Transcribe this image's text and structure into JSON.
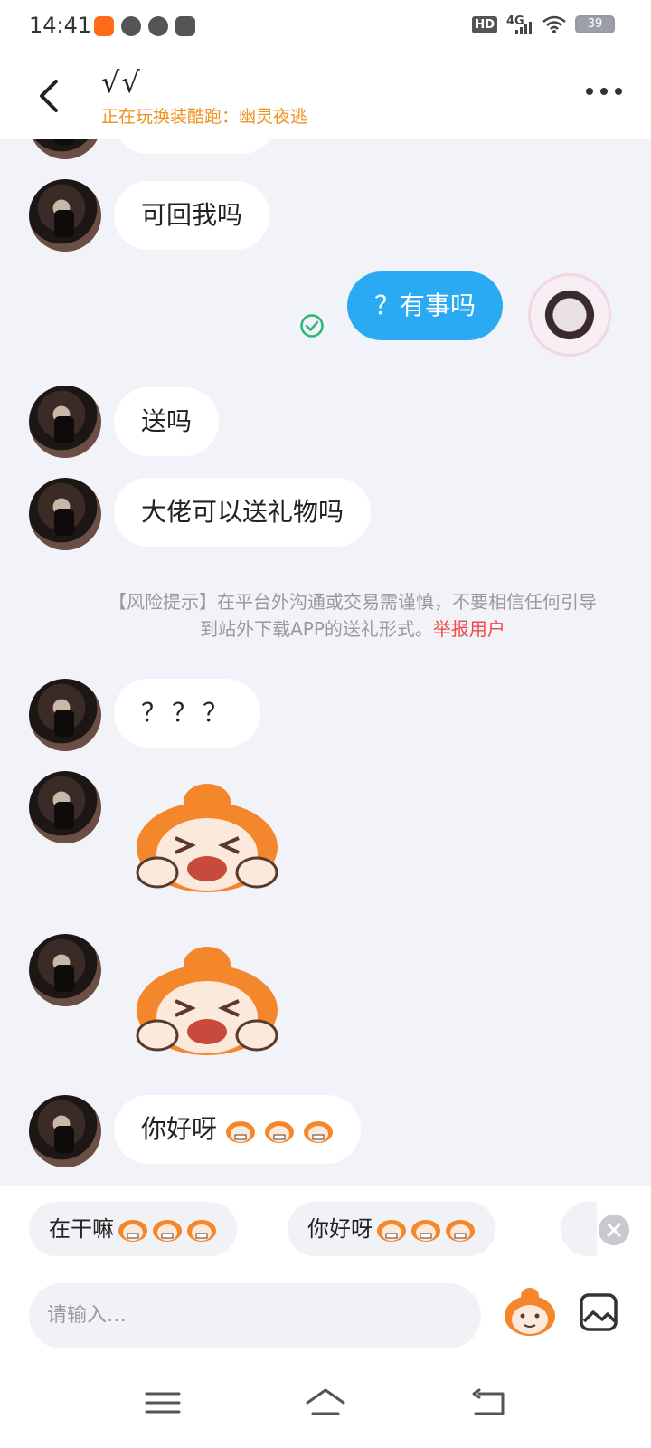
{
  "status_bar": {
    "time": "14:41",
    "network": "4G",
    "hd": "HD",
    "battery": "39"
  },
  "header": {
    "title": "√√",
    "subtitle": "正在玩换装酷跑：幽灵夜逃"
  },
  "messages": {
    "m1": "可回我吗",
    "m2": "？有事吗",
    "m3": "送吗",
    "m4": "大佬可以送礼物吗",
    "m5": "？？？",
    "m6": "你好呀"
  },
  "risk_notice": {
    "text": "【风险提示】在平台外沟通或交易需谨慎，不要相信任何引导到站外下载APP的送礼形式。",
    "report_link": "举报用户"
  },
  "quick_replies": [
    "在干嘛",
    "你好呀"
  ],
  "input": {
    "placeholder": "请输入…"
  },
  "colors": {
    "accent_blue": "#2aaaf3",
    "orange": "#f0911f",
    "report_red": "#ef4a4a",
    "sent_green": "#2bb673"
  },
  "icons": [
    "back-arrow",
    "more-dots",
    "sent-check",
    "sticker-crying",
    "emoji-face",
    "image",
    "close",
    "menu",
    "home",
    "back"
  ]
}
